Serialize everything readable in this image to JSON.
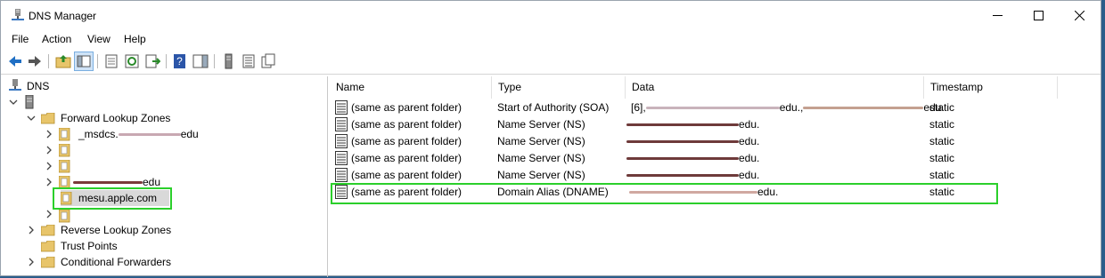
{
  "window": {
    "title": "DNS Manager",
    "controls": [
      "minimize",
      "maximize",
      "close"
    ]
  },
  "menu": [
    "File",
    "Action",
    "View",
    "Help"
  ],
  "toolbar": {
    "icons": [
      "back-arrow-icon",
      "forward-arrow-icon",
      "up-folder-icon",
      "show-hide-tree-icon",
      "properties-icon",
      "refresh-icon",
      "export-list-icon",
      "help-icon",
      "show-hide-action-pane-icon",
      "server-icon",
      "list-icon",
      "copy-icon"
    ]
  },
  "tree": {
    "root": "DNS",
    "forward_zones": "Forward Lookup Zones",
    "msdcs_prefix": "_msdcs.",
    "edu_suffix": "edu",
    "selected_zone": "mesu.apple.com",
    "reverse_zones": "Reverse Lookup Zones",
    "trust_points": "Trust Points",
    "conditional_forwarders": "Conditional Forwarders"
  },
  "list": {
    "columns": [
      "Name",
      "Type",
      "Data",
      "Timestamp"
    ],
    "soa_prefix": "[6],",
    "rows": [
      {
        "name": "(same as parent folder)",
        "type": "Start of Authority (SOA)",
        "data_end": "edu.",
        "timestamp": "static"
      },
      {
        "name": "(same as parent folder)",
        "type": "Name Server (NS)",
        "data_end": "edu.",
        "timestamp": "static"
      },
      {
        "name": "(same as parent folder)",
        "type": "Name Server (NS)",
        "data_end": "edu.",
        "timestamp": "static"
      },
      {
        "name": "(same as parent folder)",
        "type": "Name Server (NS)",
        "data_end": "edu.",
        "timestamp": "static"
      },
      {
        "name": "(same as parent folder)",
        "type": "Name Server (NS)",
        "data_end": "edu.",
        "timestamp": "static"
      },
      {
        "name": "(same as parent folder)",
        "type": "Domain Alias (DNAME)",
        "data_end": "edu.",
        "timestamp": "static"
      }
    ]
  },
  "colors": {
    "highlight": "#2bcf2b",
    "selected_bg": "#d9d9d9",
    "folder": "#e8c56a"
  }
}
